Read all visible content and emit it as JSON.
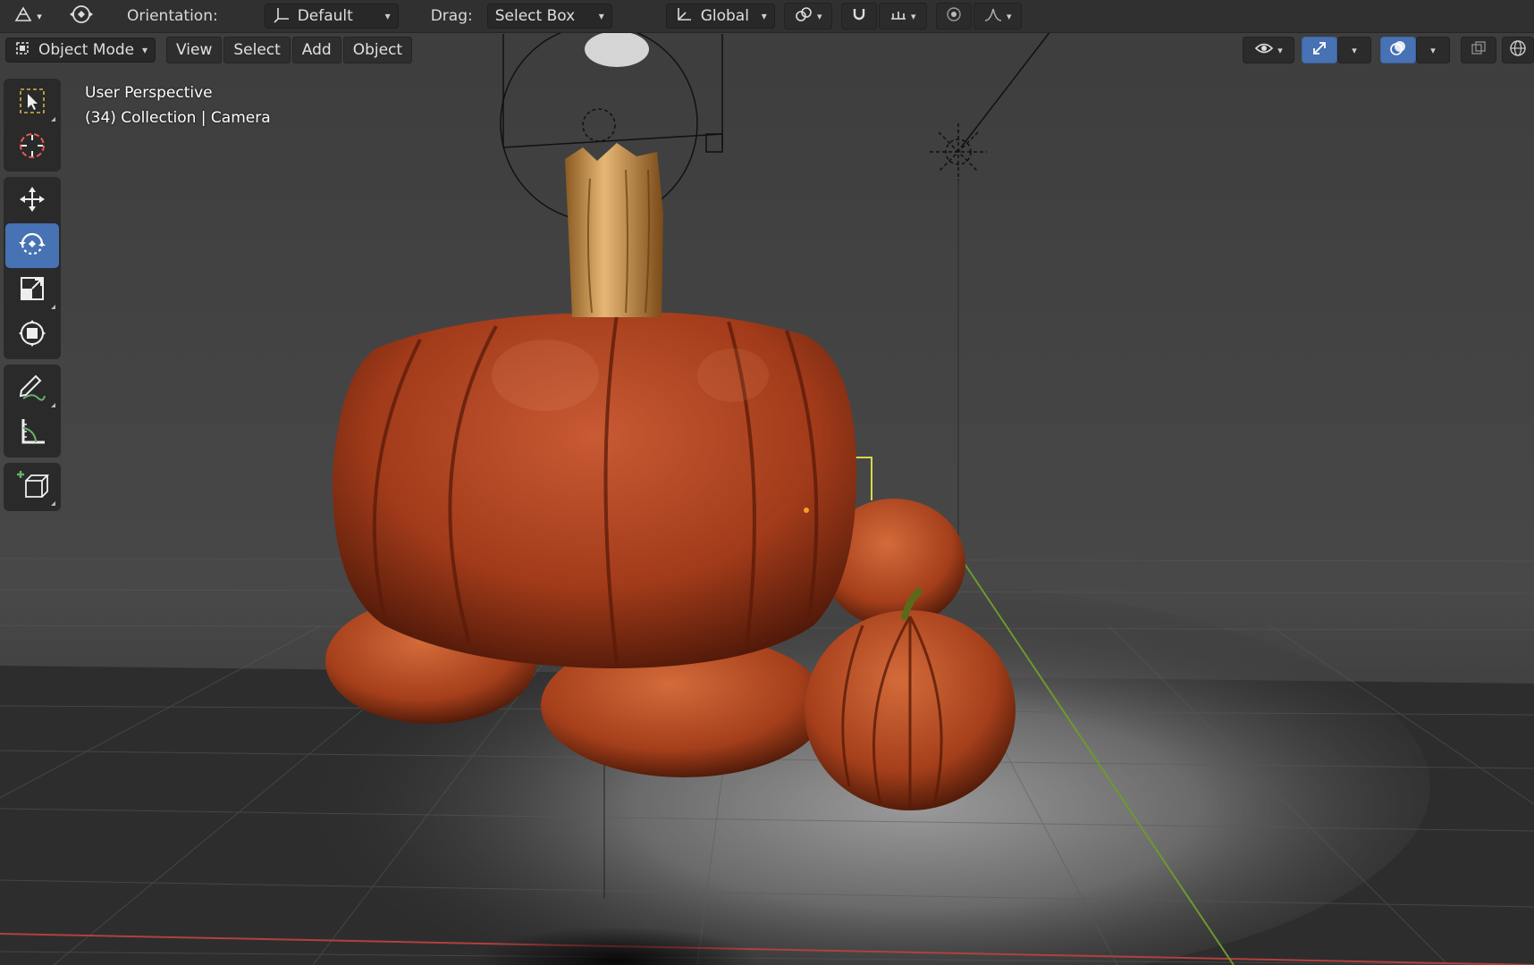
{
  "tool_header": {
    "orientation_label": "Orientation:",
    "orientation_value": "Default",
    "drag_label": "Drag:",
    "drag_value": "Select Box",
    "transform_space": "Global"
  },
  "viewport_header": {
    "mode": "Object Mode",
    "menus": [
      "View",
      "Select",
      "Add",
      "Object"
    ]
  },
  "overlay": {
    "view_name": "User Perspective",
    "collection_info": "(34) Collection | Camera"
  },
  "toolbar": {
    "active_tool": "rotate",
    "tools": [
      "select-box",
      "cursor",
      "move",
      "rotate",
      "scale",
      "transform",
      "annotate",
      "measure",
      "add-cube"
    ]
  },
  "icons": {
    "object_type": "mesh-icon",
    "transform_pivot": "pivot-icon",
    "snap": "magnet-icon",
    "proportional": "proportional-editing-icon",
    "visibility": "eye-icon",
    "gizmo": "gizmo-icon",
    "overlays": "overlays-icon",
    "xray": "xray-icon",
    "shading": "wireframe-sphere-icon"
  },
  "colors": {
    "accent": "#4772b3",
    "header_bg": "#303030",
    "pumpkin": "#b8461e",
    "x_axis": "#b0413e",
    "y_axis": "#6d9a2c"
  }
}
